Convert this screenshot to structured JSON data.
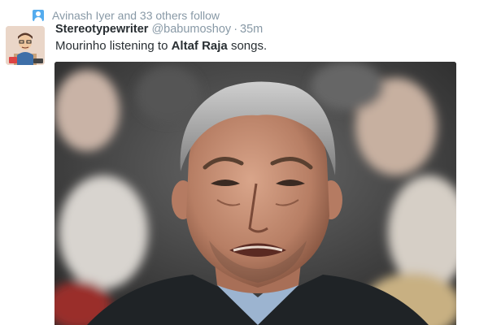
{
  "social_context": {
    "text": "Avinash Iyer and 33 others follow",
    "icon": "follow-person-icon"
  },
  "tweet": {
    "display_name": "Stereotypewriter",
    "username": "@babumoshoy",
    "separator": "·",
    "timestamp": "35m",
    "text_before": "Mourinho listening to ",
    "text_bold": "Altaf Raja",
    "text_after": " songs.",
    "avatar": "avatar-icon",
    "media": "photo-crying-man"
  },
  "colors": {
    "accent": "#55acee",
    "meta_gray": "#8899a6",
    "text": "#292f33"
  }
}
